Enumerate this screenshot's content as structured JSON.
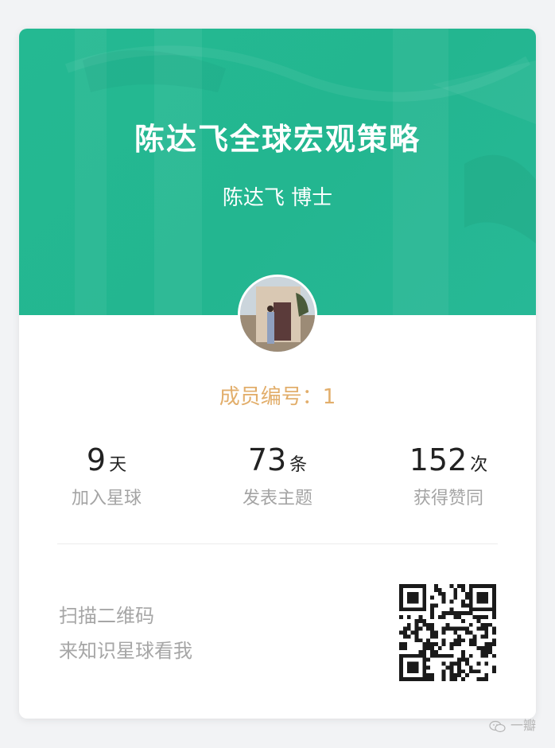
{
  "card": {
    "title": "陈达飞全球宏观策略",
    "author": "陈达飞 博士",
    "member_label": "成员编号：1",
    "stats": [
      {
        "value": "9",
        "unit": "天",
        "label": "加入星球"
      },
      {
        "value": "73",
        "unit": "条",
        "label": "发表主题"
      },
      {
        "value": "152",
        "unit": "次",
        "label": "获得赞同"
      }
    ],
    "scan_line1": "扫描二维码",
    "scan_line2": "来知识星球看我"
  },
  "watermark": {
    "text": "一瓣",
    "icon": "wechat-icon"
  },
  "colors": {
    "banner": "#23b690",
    "member_number": "#e2ae6b",
    "stat_label": "#a4a4a4",
    "background": "#f2f3f5"
  }
}
